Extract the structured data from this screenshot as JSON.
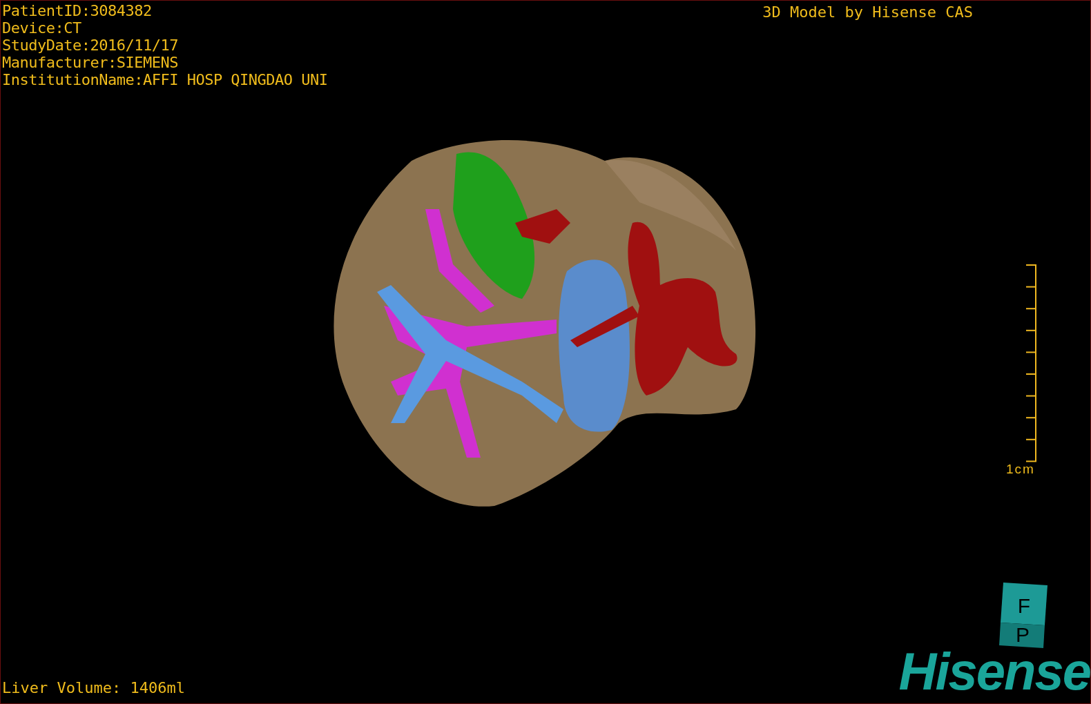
{
  "patient_info": [
    "PatientID:3084382",
    "Device:CT",
    "StudyDate:2016/11/17",
    "Manufacturer:SIEMENS",
    "InstitutionName:AFFI HOSP QINGDAO UNI"
  ],
  "credit": "3D Model by Hisense CAS",
  "scale_bar": {
    "label": "1cm"
  },
  "orientation_cube": {
    "front": "F",
    "bottom": "P"
  },
  "logo": "Hisense",
  "liver_volume": "Liver Volume: 1406ml"
}
